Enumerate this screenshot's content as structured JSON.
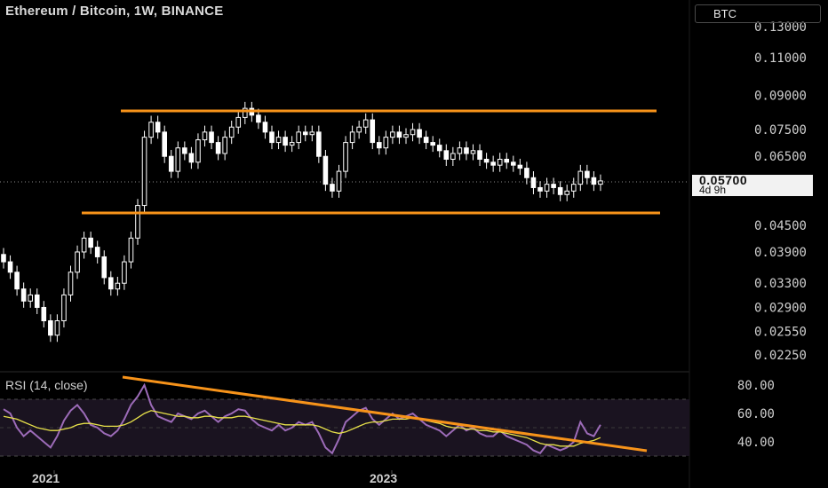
{
  "header": {
    "title": "Ethereum / Bitcoin, 1W, BINANCE",
    "currency_button": "BTC",
    "rsi_title": "RSI (14, close)"
  },
  "price_tag": {
    "price": "0.05700",
    "countdown": "4d 9h"
  },
  "colors": {
    "background": "#000000",
    "candles": "#ffffff",
    "trendlines": "#f7931a",
    "rsi_line": "#9c6bb8",
    "rsi_ma": "#e8e24a",
    "rsi_band": "#2a1f33"
  },
  "chart_data": [
    {
      "type": "candlestick",
      "title": "Ethereum / Bitcoin, 1W, BINANCE",
      "y_scale": "log",
      "ylim": [
        0.0215,
        0.135
      ],
      "y_ticks": [
        "0.13000",
        "0.11000",
        "0.09000",
        "0.07500",
        "0.06500",
        "0.04500",
        "0.03900",
        "0.03300",
        "0.02900",
        "0.02550",
        "0.02250"
      ],
      "x_ticks": [
        "2021",
        "2023"
      ],
      "close_series_approx": [
        0.037,
        0.035,
        0.032,
        0.03,
        0.031,
        0.029,
        0.027,
        0.025,
        0.027,
        0.031,
        0.035,
        0.039,
        0.042,
        0.04,
        0.038,
        0.034,
        0.032,
        0.033,
        0.037,
        0.042,
        0.05,
        0.072,
        0.078,
        0.074,
        0.065,
        0.06,
        0.068,
        0.066,
        0.063,
        0.071,
        0.074,
        0.07,
        0.066,
        0.072,
        0.076,
        0.08,
        0.084,
        0.081,
        0.078,
        0.074,
        0.07,
        0.072,
        0.069,
        0.07,
        0.074,
        0.073,
        0.074,
        0.065,
        0.056,
        0.054,
        0.06,
        0.07,
        0.074,
        0.076,
        0.079,
        0.07,
        0.068,
        0.072,
        0.074,
        0.072,
        0.073,
        0.075,
        0.072,
        0.07,
        0.069,
        0.067,
        0.064,
        0.066,
        0.068,
        0.066,
        0.067,
        0.064,
        0.063,
        0.062,
        0.064,
        0.063,
        0.062,
        0.061,
        0.058,
        0.055,
        0.054,
        0.056,
        0.055,
        0.053,
        0.054,
        0.056,
        0.06,
        0.058,
        0.056,
        0.057
      ],
      "annotations": [
        {
          "kind": "horizontal_line",
          "label": "resistance",
          "value": 0.0842
        },
        {
          "kind": "horizontal_line",
          "label": "support",
          "value": 0.051
        }
      ]
    },
    {
      "type": "line",
      "title": "RSI (14, close)",
      "ylim": [
        25,
        85
      ],
      "y_ticks": [
        "80.00",
        "60.00",
        "40.00"
      ],
      "bands": [
        30,
        70
      ],
      "series": [
        {
          "values": [
            63,
            60,
            50,
            44,
            48,
            44,
            40,
            36,
            44,
            55,
            62,
            66,
            60,
            52,
            50,
            46,
            44,
            48,
            56,
            66,
            72,
            80,
            66,
            58,
            56,
            54,
            60,
            58,
            56,
            60,
            62,
            58,
            54,
            58,
            60,
            63,
            62,
            56,
            52,
            50,
            48,
            52,
            48,
            50,
            54,
            52,
            54,
            46,
            36,
            32,
            42,
            54,
            58,
            62,
            64,
            56,
            52,
            56,
            60,
            56,
            58,
            60,
            56,
            52,
            50,
            48,
            44,
            48,
            52,
            48,
            50,
            46,
            44,
            44,
            48,
            44,
            42,
            40,
            38,
            34,
            32,
            38,
            36,
            34,
            36,
            40,
            54,
            46,
            44,
            52
          ]
        },
        {
          "values": [
            58,
            57,
            56,
            54,
            52,
            50,
            49,
            48,
            48,
            49,
            50,
            52,
            53,
            53,
            52,
            51,
            51,
            51,
            52,
            54,
            57,
            60,
            62,
            61,
            60,
            59,
            58,
            58,
            57,
            57,
            58,
            58,
            57,
            57,
            57,
            58,
            58,
            57,
            56,
            55,
            54,
            53,
            52,
            52,
            52,
            52,
            52,
            51,
            49,
            47,
            46,
            47,
            49,
            51,
            53,
            54,
            54,
            55,
            56,
            56,
            56,
            57,
            56,
            55,
            54,
            53,
            51,
            50,
            50,
            49,
            49,
            48,
            48,
            47,
            47,
            46,
            45,
            44,
            43,
            41,
            39,
            38,
            38,
            37,
            37,
            37,
            39,
            40,
            41,
            43
          ]
        }
      ],
      "annotations": [
        {
          "kind": "trendline",
          "label": "rsi_downtrend"
        }
      ]
    }
  ]
}
